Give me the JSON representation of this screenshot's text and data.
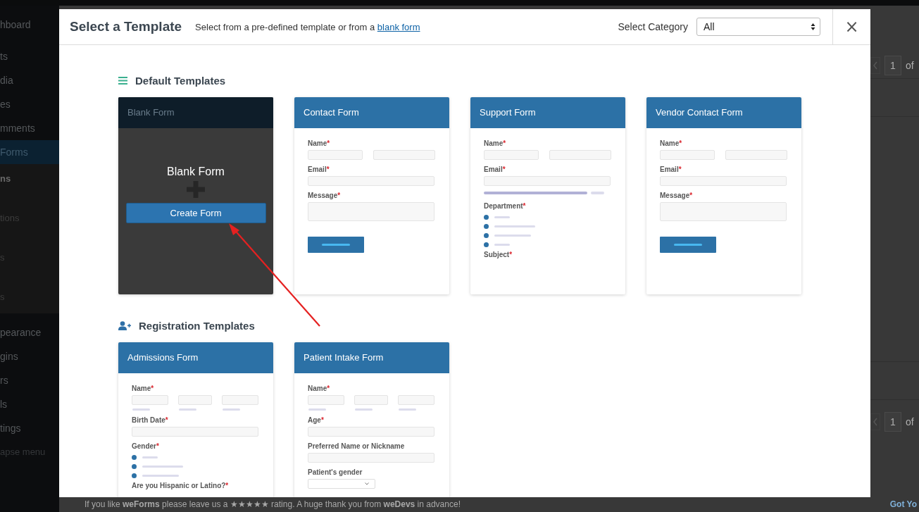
{
  "sidebar": {
    "items": [
      {
        "label": "hboard",
        "kind": "menu"
      },
      {
        "label": "ts",
        "kind": "menu"
      },
      {
        "label": "dia",
        "kind": "menu"
      },
      {
        "label": "es",
        "kind": "menu"
      },
      {
        "label": "mments",
        "kind": "menu"
      },
      {
        "label": "Forms",
        "kind": "active"
      },
      {
        "label": "ns",
        "kind": "sub-current"
      },
      {
        "label": "tions",
        "kind": "sub"
      },
      {
        "label": "s",
        "kind": "sub"
      },
      {
        "label": "s",
        "kind": "sub"
      },
      {
        "label": "pearance",
        "kind": "menu"
      },
      {
        "label": "gins",
        "kind": "menu"
      },
      {
        "label": "rs",
        "kind": "menu"
      },
      {
        "label": "ls",
        "kind": "menu"
      },
      {
        "label": "tings",
        "kind": "menu"
      },
      {
        "label": "apse menu",
        "kind": "collapse"
      }
    ]
  },
  "pagination": [
    {
      "page": "1",
      "of": "of"
    },
    {
      "page": "1",
      "of": "of"
    }
  ],
  "footer": {
    "text": "If you like **weForms** please leave us a ★★★★★ rating. A huge thank you from **weDevs** in advance!",
    "link": "Got Yo"
  },
  "modal": {
    "title": "Select a Template",
    "subtitle": "Select from a pre-defined template or from a",
    "subtitle_link": "blank form",
    "category_label": "Select Category",
    "category_value": "All",
    "close": "×",
    "sections": [
      {
        "title": "Default Templates",
        "templates": [
          {
            "kind": "blank",
            "title": "Blank Form",
            "heading": "Blank Form",
            "button": "Create Form"
          },
          {
            "kind": "form",
            "title": "Contact Form",
            "fields": [
              {
                "kind": "name2",
                "label": "Name",
                "mark": "*"
              },
              {
                "kind": "text",
                "label": "Email",
                "mark": "*"
              },
              {
                "kind": "textarea",
                "label": "Message",
                "mark": "*"
              },
              {
                "kind": "button"
              }
            ]
          },
          {
            "kind": "form",
            "title": "Support Form",
            "fields": [
              {
                "kind": "name2",
                "label": "Name",
                "mark": "*"
              },
              {
                "kind": "text",
                "label": "Email",
                "mark": "*"
              },
              {
                "kind": "bar"
              },
              {
                "kind": "radio",
                "label": "Department",
                "mark": "*",
                "options": [
                  {
                    "kind": "option"
                  },
                  {
                    "kind": "option"
                  },
                  {
                    "kind": "option"
                  },
                  {
                    "kind": "option"
                  }
                ]
              },
              {
                "kind": "label",
                "label": "Subject",
                "mark": "*"
              }
            ]
          },
          {
            "kind": "form",
            "title": "Vendor Contact Form",
            "fields": [
              {
                "kind": "name2",
                "label": "Name",
                "mark": "*"
              },
              {
                "kind": "text",
                "label": "Email",
                "mark": "*"
              },
              {
                "kind": "textarea",
                "label": "Message",
                "mark": "*"
              },
              {
                "kind": "button"
              }
            ]
          }
        ]
      },
      {
        "title": "Registration Templates",
        "templates": [
          {
            "kind": "form",
            "title": "Admissions Form",
            "fields": [
              {
                "kind": "name3",
                "label": "Name",
                "mark": "*"
              },
              {
                "kind": "text",
                "label": "Birth Date",
                "mark": "*"
              },
              {
                "kind": "radio",
                "label": "Gender",
                "mark": "*",
                "options": [
                  {
                    "kind": "option"
                  },
                  {
                    "kind": "option"
                  },
                  {
                    "kind": "option"
                  }
                ]
              },
              {
                "kind": "label",
                "label": "Are you Hispanic or Latino?",
                "mark": "*"
              }
            ]
          },
          {
            "kind": "form",
            "title": "Patient Intake Form",
            "fields": [
              {
                "kind": "name3",
                "label": "Name",
                "mark": "*"
              },
              {
                "kind": "text",
                "label": "Age",
                "mark": "*"
              },
              {
                "kind": "text",
                "label": "Preferred Name or Nickname"
              },
              {
                "kind": "select",
                "label": "Patient's gender"
              }
            ]
          }
        ]
      }
    ]
  }
}
